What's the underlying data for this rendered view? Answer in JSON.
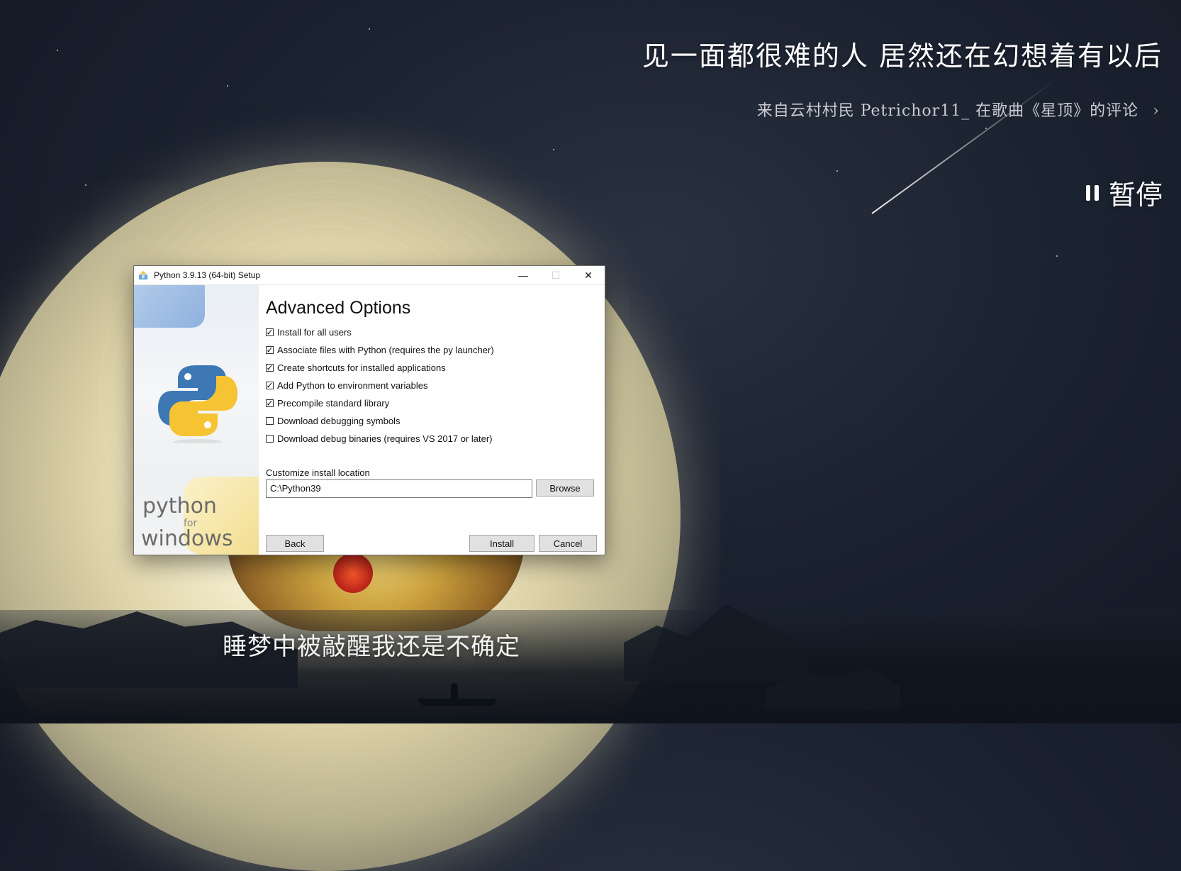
{
  "background": {
    "quote": "见一面都很难的人 居然还在幻想着有以后",
    "source": "来自云村村民 Petrichor11_ 在歌曲《星顶》的评论",
    "source_chevron": "›",
    "pause_label": "暂停",
    "lyric": "睡梦中被敲醒我还是不确定",
    "colors": {
      "sky": "#1b2230",
      "text": "#ffffff"
    }
  },
  "window": {
    "title": "Python 3.9.13 (64-bit) Setup",
    "controls": {
      "minimize": "—",
      "maximize": "☐",
      "close": "✕"
    },
    "sidebar": {
      "line1": "python",
      "line2": "for",
      "line3": "windows"
    },
    "heading": "Advanced Options",
    "options": [
      {
        "label": "Install for all users",
        "checked": true
      },
      {
        "label": "Associate files with Python (requires the py launcher)",
        "checked": true
      },
      {
        "label": "Create shortcuts for installed applications",
        "checked": true
      },
      {
        "label": "Add Python to environment variables",
        "checked": true
      },
      {
        "label": "Precompile standard library",
        "checked": true
      },
      {
        "label": "Download debugging symbols",
        "checked": false
      },
      {
        "label": "Download debug binaries (requires VS 2017 or later)",
        "checked": false
      }
    ],
    "install_location": {
      "label": "Customize install location",
      "value": "C:\\Python39",
      "browse_label": "Browse"
    },
    "buttons": {
      "back": "Back",
      "install": "Install",
      "cancel": "Cancel"
    },
    "icons": {
      "app": "python-setup-icon"
    }
  }
}
